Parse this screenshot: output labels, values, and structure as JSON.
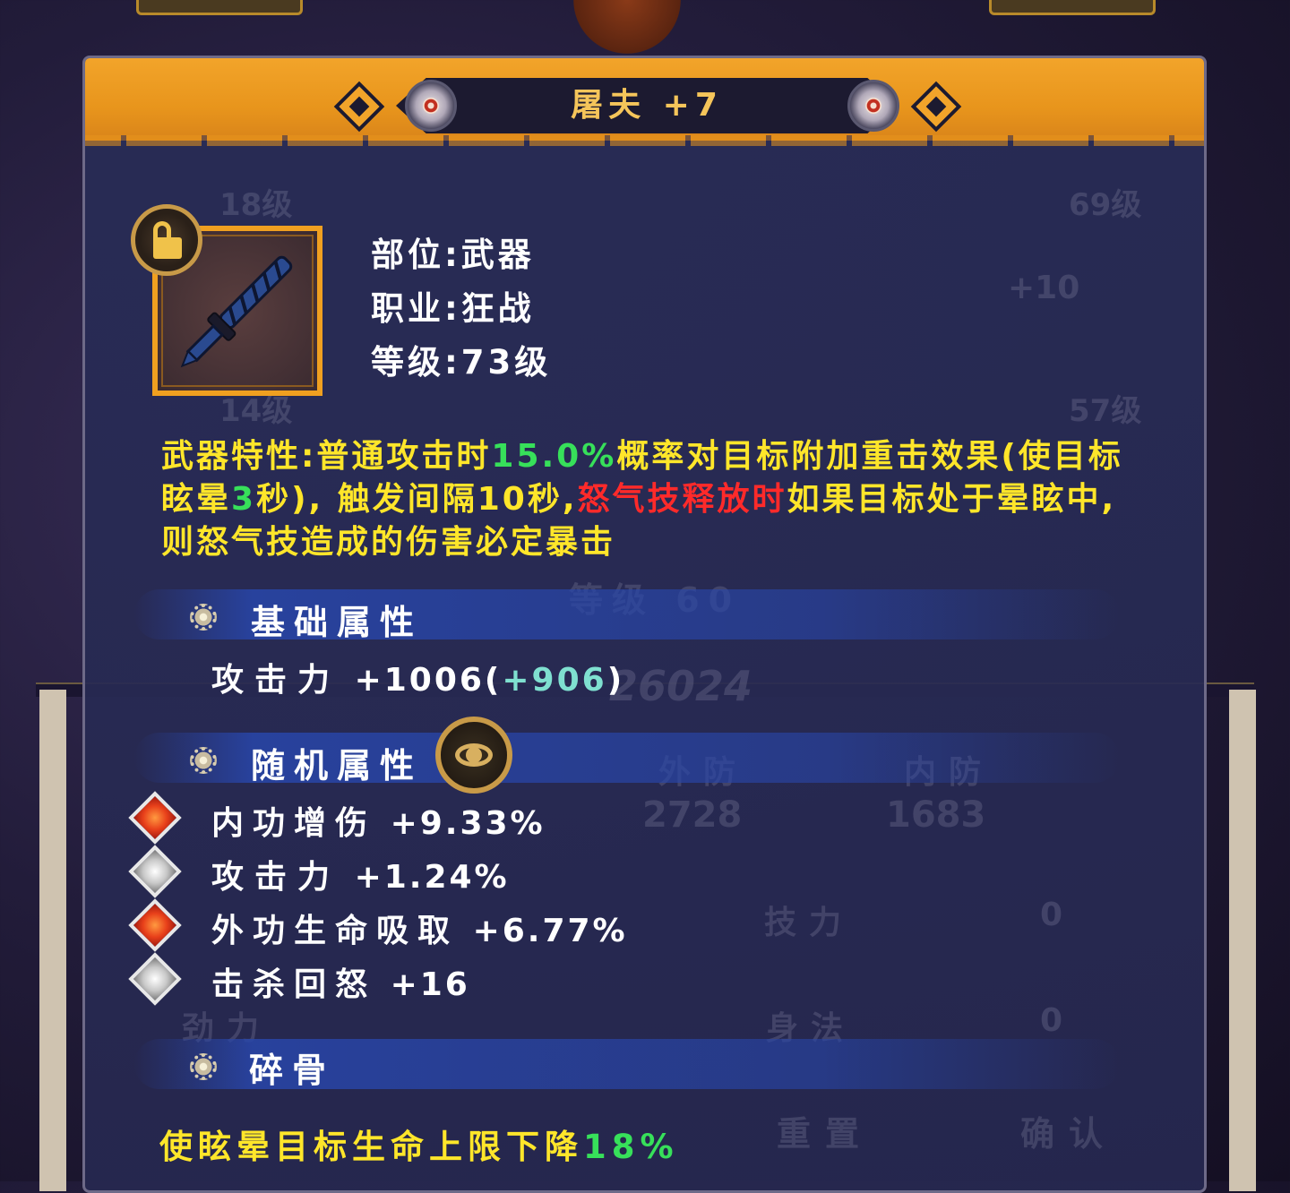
{
  "background": {
    "ghost_levels": [
      "18级",
      "69级",
      "57级",
      "14级"
    ],
    "ghost_plus": "+10",
    "ghost_level_caption": "等级 60",
    "ghost_power": "26024",
    "ghost_stat_labels": [
      "外防",
      "内防"
    ],
    "ghost_stat_values": [
      "2728",
      "1683"
    ],
    "ghost_attributes": [
      "技力",
      "身法",
      "劲力"
    ],
    "ghost_zero": "0",
    "ghost_buttons": [
      "重置",
      "确认"
    ]
  },
  "header": {
    "title": "屠夫 +7"
  },
  "item": {
    "slot": "部位:武器",
    "class": "职业:狂战",
    "level": "等级:73级",
    "lock_icon": "unlock-icon"
  },
  "weapon_trait": {
    "p1": "武器特性:普通攻击时",
    "p2": "15.0%",
    "p3": "概率对目标附加重击效果(使目标眩晕",
    "p4": "3",
    "p5": "秒), 触发间隔10秒,",
    "p6": "怒气技释放时",
    "p7": "如果目标处于晕眩中,则怒气技造成的伤害必定暴击"
  },
  "base_attributes": {
    "title": "基础属性",
    "label": "攻击力",
    "value": "+1006",
    "bonus_open": "(",
    "bonus": "+906",
    "bonus_close": ")"
  },
  "random_attributes": {
    "title": "随机属性",
    "reveal_icon": "eye-icon",
    "items": [
      {
        "label": "内功增伤",
        "value": "+9.33%",
        "gem": "red"
      },
      {
        "label": "攻击力",
        "value": "+1.24%",
        "gem": "silver"
      },
      {
        "label": "外功生命吸取",
        "value": "+6.77%",
        "gem": "red"
      },
      {
        "label": "击杀回怒",
        "value": "+16",
        "gem": "silver"
      }
    ]
  },
  "special": {
    "title": "碎骨",
    "text": "使眩晕目标生命上限下降",
    "value": "18%"
  },
  "colors": {
    "header_orange": "#e8951c",
    "title_gold": "#f5c55a",
    "trait_yellow": "#ffe62a",
    "highlight_green": "#37e05a",
    "highlight_red": "#ff2a2a",
    "bonus_teal": "#7fe0d0"
  }
}
